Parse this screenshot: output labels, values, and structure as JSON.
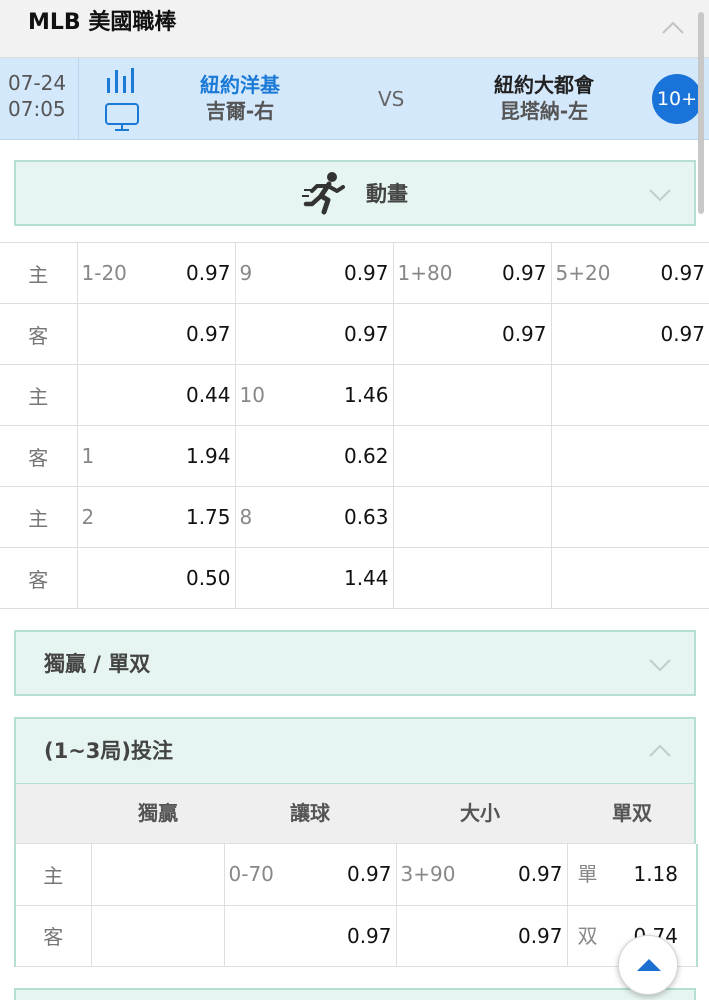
{
  "league": {
    "title": "MLB 美國職棒"
  },
  "match": {
    "date": "07-24",
    "time": "07:05",
    "home_team": "紐約洋基",
    "home_pitcher": "吉爾-右",
    "vs": "VS",
    "away_team": "紐約大都會",
    "away_pitcher": "昆塔納-左",
    "more_markets": "10+"
  },
  "animation_panel": {
    "title": "動畫"
  },
  "main_odds": {
    "rows": [
      {
        "side": "主",
        "cells": [
          {
            "line": "1-20",
            "price": "0.97"
          },
          {
            "line": "9",
            "price": "0.97"
          },
          {
            "line": "1+80",
            "price": "0.97"
          },
          {
            "line": "5+20",
            "price": "0.97"
          }
        ]
      },
      {
        "side": "客",
        "cells": [
          {
            "line": "",
            "price": "0.97"
          },
          {
            "line": "",
            "price": "0.97"
          },
          {
            "line": "",
            "price": "0.97"
          },
          {
            "line": "",
            "price": "0.97"
          }
        ]
      },
      {
        "side": "主",
        "cells": [
          {
            "line": "",
            "price": "0.44"
          },
          {
            "line": "10",
            "price": "1.46"
          },
          {
            "line": "",
            "price": ""
          },
          {
            "line": "",
            "price": ""
          }
        ]
      },
      {
        "side": "客",
        "cells": [
          {
            "line": "1",
            "price": "1.94"
          },
          {
            "line": "",
            "price": "0.62"
          },
          {
            "line": "",
            "price": ""
          },
          {
            "line": "",
            "price": ""
          }
        ]
      },
      {
        "side": "主",
        "cells": [
          {
            "line": "2",
            "price": "1.75"
          },
          {
            "line": "8",
            "price": "0.63"
          },
          {
            "line": "",
            "price": ""
          },
          {
            "line": "",
            "price": ""
          }
        ]
      },
      {
        "side": "客",
        "cells": [
          {
            "line": "",
            "price": "0.50"
          },
          {
            "line": "",
            "price": "1.44"
          },
          {
            "line": "",
            "price": ""
          },
          {
            "line": "",
            "price": ""
          }
        ]
      }
    ]
  },
  "moneyline_panel": {
    "title": "獨贏 / 單双"
  },
  "innings_panel": {
    "title": "(1~3局)投注",
    "headers": {
      "moneyline": "獨贏",
      "handicap": "讓球",
      "over_under": "大小",
      "odd_even": "單双"
    },
    "rows": [
      {
        "side": "主",
        "moneyline": "",
        "hcp_line": "0-70",
        "hcp_price": "0.97",
        "ou_line": "3+90",
        "ou_price": "0.97",
        "oe_label": "單",
        "oe_price": "1.18"
      },
      {
        "side": "客",
        "moneyline": "",
        "hcp_line": "",
        "hcp_price": "0.97",
        "ou_line": "",
        "ou_price": "0.97",
        "oe_label": "双",
        "oe_price": "0.74"
      }
    ]
  },
  "icons": {
    "league_toggle": "chevron-up-icon",
    "stats": "bar-chart-icon",
    "live_tv": "tv-icon",
    "animation": "running-man-icon",
    "scroll_top": "arrow-up-icon"
  },
  "colors": {
    "match_bg": "#d4e8fc",
    "home_team": "#1a7ad6",
    "badge": "#1a73d9",
    "panel_bg": "#e6f5f1",
    "panel_border": "#b5dfd2"
  }
}
